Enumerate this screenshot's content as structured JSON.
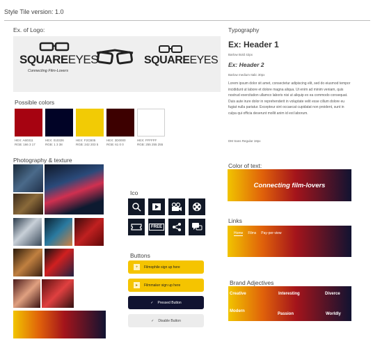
{
  "header": {
    "title": "Style Tile  version: 1.0"
  },
  "logo_section": {
    "label": "Ex. of Logo:",
    "wordmark_bold": "SQUARE",
    "wordmark_light": "EYES",
    "tagline": "Connecting Film-Lovers"
  },
  "colors": {
    "label": "Possible colors",
    "swatches": [
      {
        "hex": "#A60311",
        "cap1": "HEX: A60311",
        "cap2": "RGB: 166 3 17"
      },
      {
        "hex": "#010326",
        "cap1": "HEX: 010326",
        "cap2": "RGB: 1 3 38"
      },
      {
        "hex": "#F2CB05",
        "cap1": "HEX: F2CB05",
        "cap2": "RGB: 242 203 5"
      },
      {
        "hex": "#3D0000",
        "cap1": "HEX: 3D0000",
        "cap2": "RGB: 61 0 0"
      },
      {
        "hex": "#FFFFFF",
        "cap1": "HEX: FFFFFF",
        "cap2": "RGB: 255 255 255"
      }
    ]
  },
  "photo": {
    "label": "Photography & texture"
  },
  "icons": {
    "label": "Ico",
    "names": [
      "search-icon",
      "play-icon",
      "camera-icon",
      "film-reel-icon",
      "ticket-icon",
      "free-icon",
      "share-icon",
      "chat-icon"
    ],
    "free_text": "FREE"
  },
  "buttons": {
    "label": "Buttons",
    "filmophile": "Filmophile sign up here",
    "filmmaker": "Filmmaker sign up here",
    "pressed": "Pressed Button",
    "disabled": "Disable Button"
  },
  "typography": {
    "label": "Typography",
    "h1": "Ex: Header 1",
    "h1_note": "Barlow Bold 42px",
    "h2": "Ex: Header 2",
    "h2_note": "Barlow medium Italic 30px",
    "body": "Lorem ipsum dolor sit amet, consectetur adipiscing elit, sed do eiusmod tempor incididunt ut labore et dolore magna aliqua. Ut enim ad minim veniam, quis nostrud exercitation ullamco laboris nisi ut aliquip ex ea commodo consequat. Duis aute irure dolor in reprehenderit in voluptate velit esse cillum dolore eu fugiat nulla pariatur. Excepteur sint occaecat cupidatat non proident, sunt in culpa qui officia deserunt mollit anim id est laborum.",
    "body_note": "DM Sans Regular 18px"
  },
  "text_color": {
    "label": "Color of text:",
    "sample": "Connecting film-lovers"
  },
  "links": {
    "label": "Links",
    "home": "Home",
    "films": "Films",
    "ppv": "Pay-per-view"
  },
  "adjectives": {
    "label": "Brand Adjectives",
    "creative": "Creative",
    "interesting": "Interesting",
    "diverce": "Diverce",
    "modern": "Modern",
    "passion": "Passion",
    "worldly": "Worldly"
  },
  "accent": {
    "yellow": "#F2CB05",
    "red": "#A60311",
    "navy": "#111331"
  }
}
